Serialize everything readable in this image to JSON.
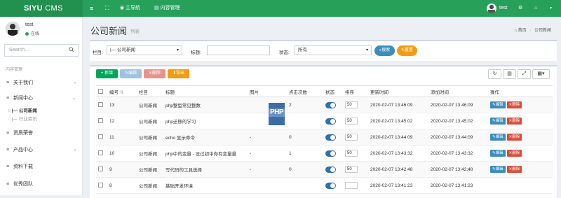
{
  "app": {
    "brand_bold": "SIYU",
    "brand_thin": " CMS"
  },
  "topbar": {
    "nav_main": "主导航",
    "nav_content": "内容管理",
    "user": "test"
  },
  "sidebar": {
    "user_name": "test",
    "status": "在线",
    "search_placeholder": "Search...",
    "section": "内容管理",
    "items": [
      {
        "label": "关于我们",
        "icon": "menu-icon"
      },
      {
        "label": "新闻中心",
        "icon": "menu-icon"
      },
      {
        "label": "资质荣誉",
        "icon": "menu-icon"
      },
      {
        "label": "产品中心",
        "icon": "menu-icon"
      },
      {
        "label": "资料下载",
        "icon": "menu-icon"
      },
      {
        "label": "优秀团队",
        "icon": "menu-icon"
      }
    ],
    "sub_items": [
      {
        "label": "|— 公司新闻",
        "active": true
      },
      {
        "label": "|— 行业资讯",
        "active": false
      }
    ]
  },
  "page": {
    "title": "公司新闻",
    "subtitle": "列表",
    "bread_home": "首页",
    "bread_current": "公司新闻"
  },
  "filter": {
    "column_label": "栏目:",
    "column_value": "|— 公司新闻",
    "title_label": "标题:",
    "title_value": "",
    "status_label": "状态:",
    "status_value": "所有",
    "search_btn": "搜索",
    "reset_btn": "重置"
  },
  "toolbar": {
    "add": "新增",
    "edit": "编辑",
    "delete": "删除",
    "export": "导出"
  },
  "table": {
    "headers": [
      "编号",
      "栏目",
      "标题",
      "图片",
      "点击次数",
      "状态",
      "排序",
      "更新时间",
      "添加时间",
      "操作"
    ],
    "rows": [
      {
        "id": "13",
        "column": "公司新闻",
        "title": "php整型常见整数",
        "image": "",
        "clicks": "2",
        "sort": "50",
        "updated": "2020-02-07 13:46:09",
        "added": "2020-02-07 13:46:09"
      },
      {
        "id": "12",
        "column": "公司新闻",
        "title": "php迁移的学习",
        "image": "",
        "clicks": "",
        "sort": "50",
        "updated": "2020-02-07 13:45:02",
        "added": "2020-02-07 13:45:02"
      },
      {
        "id": "11",
        "column": "公司新闻",
        "title": "echo 显示命令",
        "image": "-",
        "clicks": "0",
        "sort": "50",
        "updated": "2020-02-07 13:44:09",
        "added": "2020-02-07 13:44:09"
      },
      {
        "id": "10",
        "column": "公司新闻",
        "title": "php中的变量 - 设过初中你有变量量",
        "image": "-",
        "clicks": "1",
        "sort": "50",
        "updated": "2020-02-07 13:43:32",
        "added": "2020-02-07 13:43:32"
      },
      {
        "id": "9",
        "column": "公司新闻",
        "title": "写代码的工具选择",
        "image": "-",
        "clicks": "0",
        "sort": "50",
        "updated": "2020-02-07 13:42:48",
        "added": "2020-02-07 13:42:48"
      },
      {
        "id": "8",
        "column": "公司新闻",
        "title": "基础开发环境",
        "image": "",
        "clicks": "",
        "sort": "",
        "updated": "2020-02-07 13:41:23",
        "added": "2020-02-07 13:41:23"
      }
    ],
    "row_edit": "编辑",
    "row_delete": "删除"
  },
  "thumb": {
    "text": "PHP"
  },
  "colors": {
    "topbar": "#27a05a",
    "brand_bg": "#229150",
    "primary": "#3c8dbc",
    "danger": "#dd4b39",
    "warning": "#f39c12",
    "success": "#00a65a"
  }
}
